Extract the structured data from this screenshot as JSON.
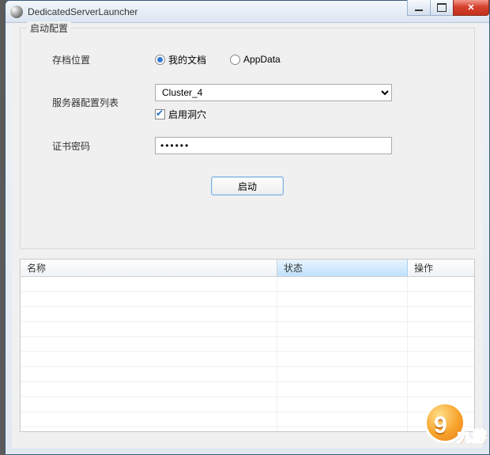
{
  "window": {
    "title": "DedicatedServerLauncher"
  },
  "group": {
    "title": "启动配置",
    "saveLocationLabel": "存档位置",
    "saveOptionA": "我的文档",
    "saveOptionB": "AppData",
    "configListLabel": "服务器配置列表",
    "configSelected": "Cluster_4",
    "enableCavesLabel": "启用洞穴",
    "certPwdLabel": "证书密码",
    "certPwdValue": "••••••",
    "launchLabel": "启动"
  },
  "table": {
    "colName": "名称",
    "colStatus": "状态",
    "colAction": "操作"
  },
  "branding": {
    "watermark": "",
    "logoText": "九游"
  }
}
